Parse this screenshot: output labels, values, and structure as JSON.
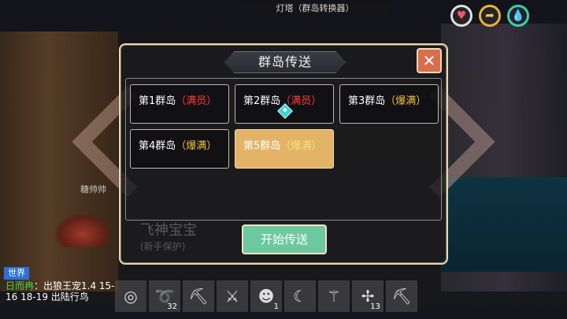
{
  "banner": {
    "text": "灯塔（群岛转换器）"
  },
  "status": {
    "heart_icon": "heart-icon",
    "hunger_icon": "hunger-icon",
    "water_icon": "water-drop-icon"
  },
  "npc": {
    "name": "糖帅帅"
  },
  "dialog": {
    "title": "群岛传送",
    "close_label": "✕",
    "islands": [
      {
        "name": "第1群岛",
        "status": "（满员）",
        "status_type": "full",
        "selected": false
      },
      {
        "name": "第2群岛",
        "status": "（满员）",
        "status_type": "full",
        "selected": false,
        "current": true
      },
      {
        "name": "第3群岛",
        "status": "（爆满）",
        "status_type": "burst",
        "selected": false
      },
      {
        "name": "第4群岛",
        "status": "（爆满）",
        "status_type": "burst",
        "selected": false
      },
      {
        "name": "第5群岛",
        "status": "（爆满）",
        "status_type": "burst",
        "selected": true
      }
    ],
    "ghost_name": "飞神宝宝",
    "ghost_tag": "(新手保护)",
    "start_label": "开始传送"
  },
  "chat": {
    "tab": "世界",
    "user": "日而冉",
    "message": "：出狼王宠1.4 15-16 18-19 出陆行鸟"
  },
  "hotbar": [
    {
      "icon": "disc-icon",
      "count": ""
    },
    {
      "icon": "rope-icon",
      "count": "32"
    },
    {
      "icon": "pickaxe-icon",
      "count": ""
    },
    {
      "icon": "sword-icon",
      "count": ""
    },
    {
      "icon": "creature-icon",
      "count": "1"
    },
    {
      "icon": "banana-icon",
      "count": ""
    },
    {
      "icon": "torch-icon",
      "count": ""
    },
    {
      "icon": "crossbow-icon",
      "count": "13"
    },
    {
      "icon": "pickaxe-icon",
      "count": ""
    }
  ]
}
